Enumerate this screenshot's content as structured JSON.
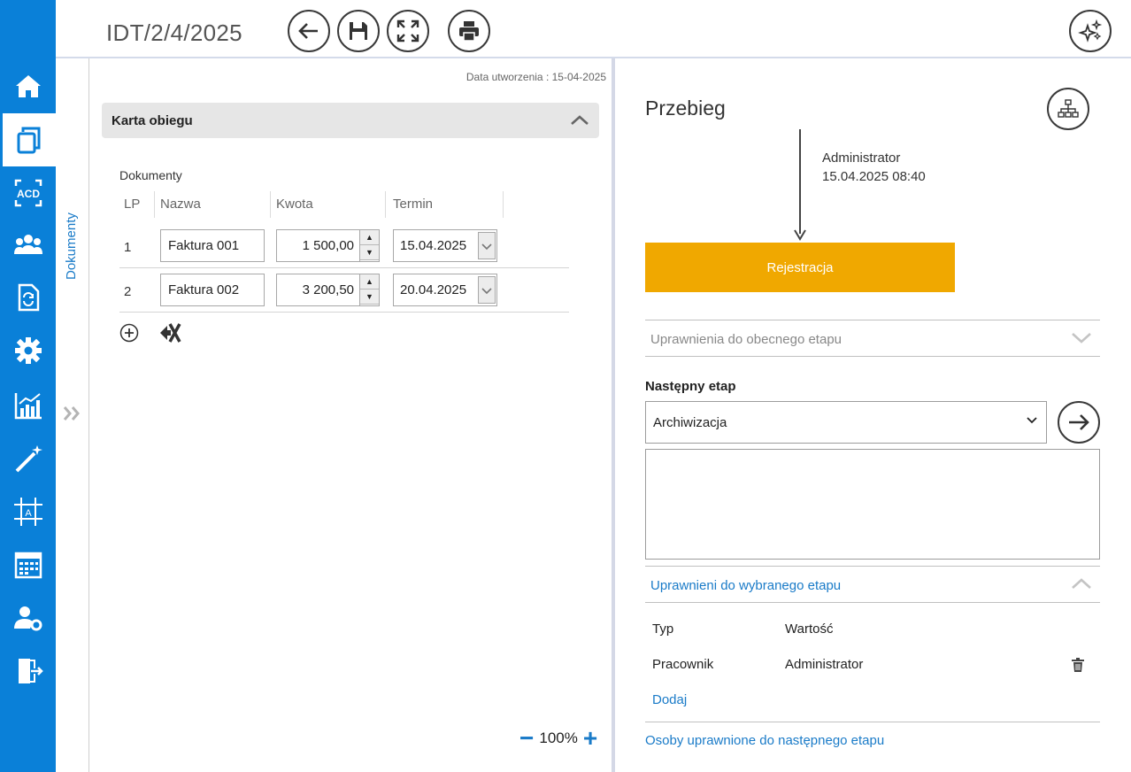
{
  "header": {
    "document_number": "IDT/2/4/2025",
    "icons": [
      "back-arrow-icon",
      "save-disk-icon",
      "fullscreen-icon",
      "print-icon",
      "ai-sparkle-icon"
    ]
  },
  "sidebar": {
    "items": [
      {
        "name": "home",
        "icon": "home-icon"
      },
      {
        "name": "documents",
        "icon": "documents-icon",
        "active": true
      },
      {
        "name": "ocr",
        "icon": "acd-ocr-icon",
        "text": "ACD"
      },
      {
        "name": "contractors",
        "icon": "people-icon"
      },
      {
        "name": "workflow-docs",
        "icon": "doc-cycle-icon"
      },
      {
        "name": "settings",
        "icon": "gear-icon"
      },
      {
        "name": "reports",
        "icon": "chart-icon"
      },
      {
        "name": "wizard",
        "icon": "magic-wand-icon"
      },
      {
        "name": "designer",
        "icon": "designer-icon"
      },
      {
        "name": "calendar",
        "icon": "calendar-icon"
      },
      {
        "name": "user-settings",
        "icon": "user-gear-icon"
      },
      {
        "name": "logout",
        "icon": "exit-door-icon"
      }
    ],
    "accent_color": "#0a80d8"
  },
  "vertical_tab": {
    "label": "Dokumenty"
  },
  "document": {
    "created_label": "Data utworzenia : 15-04-2025",
    "section_title": "Karta obiegu",
    "table_label": "Dokumenty",
    "columns": [
      "LP",
      "Nazwa",
      "Kwota",
      "Termin"
    ],
    "rows": [
      {
        "lp": "1",
        "name": "Faktura 001",
        "amount": "1 500,00",
        "date": "15.04.2025"
      },
      {
        "lp": "2",
        "name": "Faktura 002",
        "amount": "3 200,50",
        "date": "20.04.2025"
      }
    ],
    "zoom": "100%"
  },
  "flow": {
    "title": "Przebieg",
    "user": "Administrator",
    "timestamp": "15.04.2025 08:40",
    "stage": "Rejestracja",
    "stage_color": "#f0a800",
    "current_permissions": "Uprawnienia do obecnego etapu",
    "next_stage_label": "Następny etap",
    "next_stage_value": "Archiwizacja",
    "selected_permissions": "Uprawnieni do wybranego etapu",
    "perm_columns": [
      "Typ",
      "Wartość"
    ],
    "perm_rows": [
      {
        "type": "Pracownik",
        "value": "Administrator"
      }
    ],
    "add_label": "Dodaj",
    "persons_link": "Osoby uprawnione do następnego etapu"
  }
}
